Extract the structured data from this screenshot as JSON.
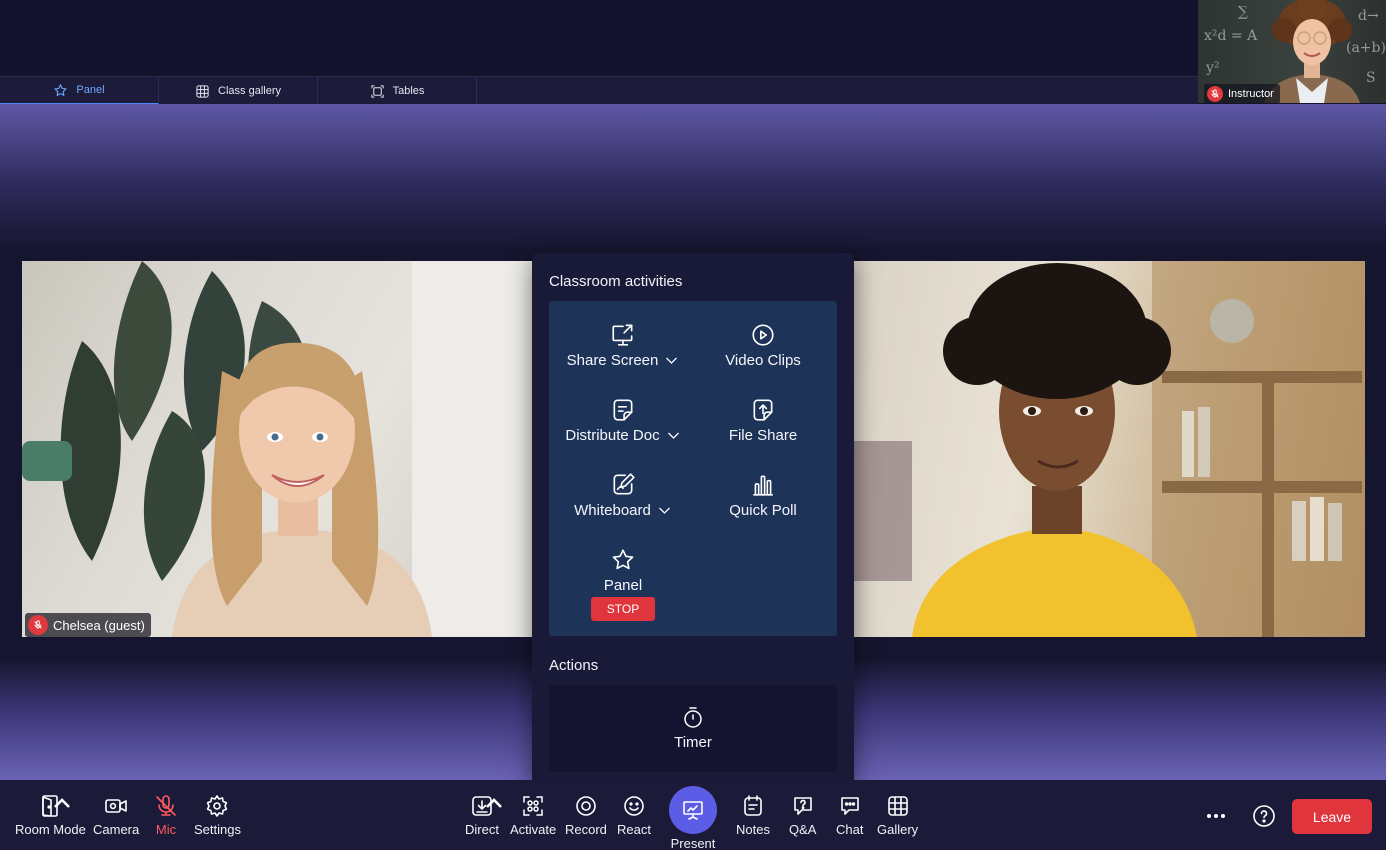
{
  "tabs": [
    {
      "label": "Panel",
      "icon": "star-icon",
      "active": true
    },
    {
      "label": "Class gallery",
      "icon": "grid-icon",
      "active": false
    },
    {
      "label": "Tables",
      "icon": "tables-icon",
      "active": false
    }
  ],
  "instructor": {
    "name": "Instructor",
    "chalk": [
      "x²d = A",
      "y²",
      "∑",
      "(a+b)",
      "d→",
      "S"
    ]
  },
  "participants": {
    "left": {
      "name": "Chelsea (guest)"
    }
  },
  "activities": {
    "title": "Classroom activities",
    "items": [
      {
        "label": "Share Screen",
        "icon": "share-screen-icon",
        "dropdown": true
      },
      {
        "label": "Video Clips",
        "icon": "play-circle-icon",
        "dropdown": false
      },
      {
        "label": "Distribute Doc",
        "icon": "document-icon",
        "dropdown": true
      },
      {
        "label": "File Share",
        "icon": "file-upload-icon",
        "dropdown": false
      },
      {
        "label": "Whiteboard",
        "icon": "whiteboard-pen-icon",
        "dropdown": true
      },
      {
        "label": "Quick Poll",
        "icon": "bar-chart-icon",
        "dropdown": false
      },
      {
        "label": "Panel",
        "icon": "star-icon",
        "dropdown": false
      }
    ],
    "stop_label": "STOP"
  },
  "actions": {
    "title": "Actions",
    "timer_label": "Timer"
  },
  "toolbar": {
    "room_mode": "Room Mode",
    "camera": "Camera",
    "mic": "Mic",
    "settings": "Settings",
    "direct": "Direct",
    "activate": "Activate",
    "record": "Record",
    "react": "React",
    "present": "Present",
    "notes": "Notes",
    "qa": "Q&A",
    "chat": "Chat",
    "gallery": "Gallery",
    "leave": "Leave"
  },
  "colors": {
    "accent": "#5b5de6",
    "active_tab": "#6ea8ff",
    "danger": "#e1353e",
    "panel_bg": "#191938",
    "grid_bg": "#1e3358"
  }
}
